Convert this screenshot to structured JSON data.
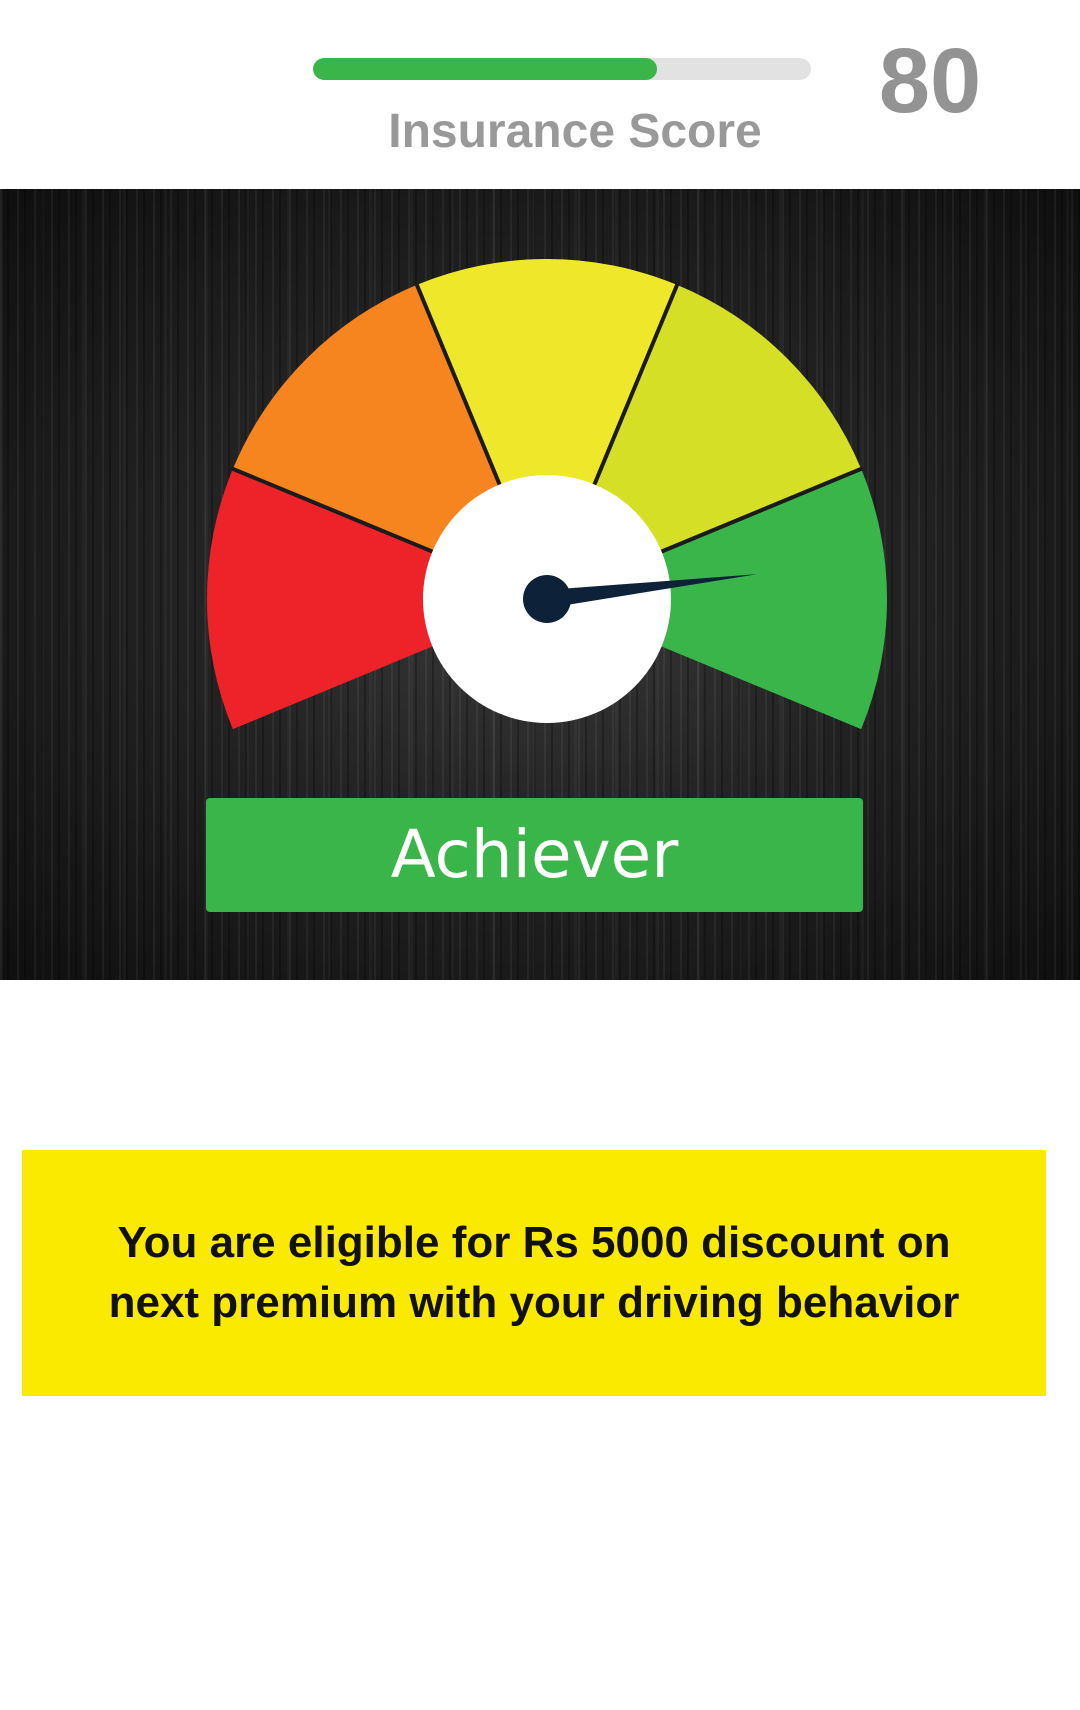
{
  "score_header": {
    "label": "Insurance Score",
    "value": "80",
    "progress_fraction": 0.69,
    "track_color": "#e2e2e2",
    "fill_color": "#3ab54a"
  },
  "gauge": {
    "segment_colors": [
      "#ee2229",
      "#f6851f",
      "#efe82a",
      "#d4df26",
      "#3ab54a"
    ],
    "needle_color": "#0d2138",
    "hub_color": "#ffffff",
    "needle_level_fraction": 0.87,
    "rating_label": "Achiever",
    "rating_color": "#3ab54a"
  },
  "discount": {
    "message": "You are eligible for Rs 5000 discount on next premium with your driving behavior",
    "background_color": "#faea00"
  }
}
